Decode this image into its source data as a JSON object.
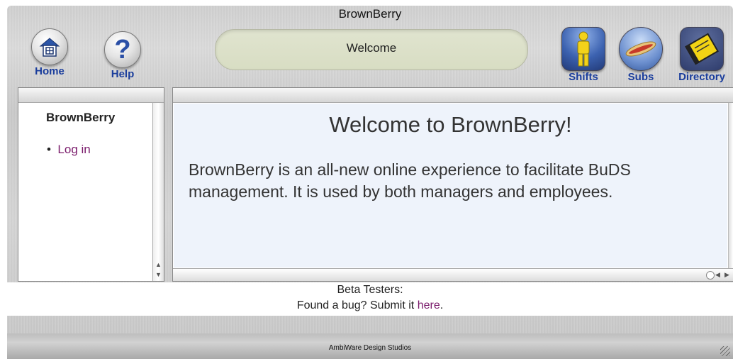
{
  "window": {
    "title": "BrownBerry"
  },
  "toolbar": {
    "home_label": "Home",
    "help_label": "Help",
    "welcome_label": "Welcome",
    "shifts_label": "Shifts",
    "subs_label": "Subs",
    "directory_label": "Directory"
  },
  "sidebar": {
    "title": "BrownBerry",
    "items": [
      {
        "label": "Log in"
      }
    ]
  },
  "main": {
    "heading": "Welcome to BrownBerry!",
    "body": "BrownBerry is an all-new online experience to facilitate BuDS management. It is used by both managers and employees."
  },
  "footer": {
    "line1": "Beta Testers:",
    "line2_prefix": "Found a bug? Submit it ",
    "link_text": "here",
    "line2_suffix": "."
  },
  "statusbar": {
    "credit": "AmbiWare Design Studios"
  },
  "colors": {
    "link": "#7a1b6b",
    "toolbar_label": "#1a3d9c",
    "content_bg": "#eef3fb"
  }
}
